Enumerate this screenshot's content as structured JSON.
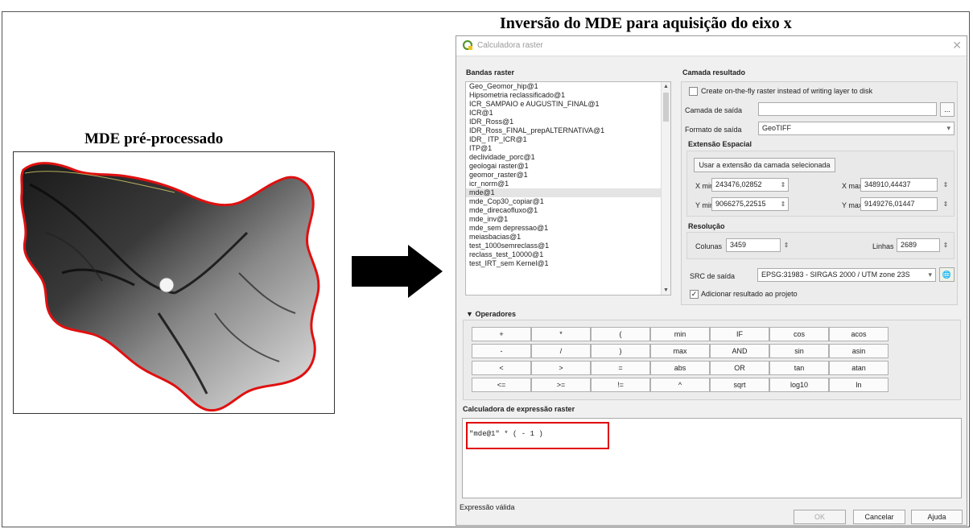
{
  "figure": {
    "left_title": "MDE pré-processado",
    "right_title": "Inversão do MDE para aquisição do eixo x"
  },
  "dialog": {
    "title": "Calculadora raster",
    "close_icon": "close-icon",
    "bands": {
      "heading": "Bandas raster",
      "items": [
        "Geo_Geomor_hip@1",
        "Hipsometria reclassificado@1",
        "ICR_SAMPAIO e AUGUSTIN_FINAL@1",
        "ICR@1",
        "IDR_Ross@1",
        "IDR_Ross_FINAL_prepALTERNATIVA@1",
        "IDR_ ITP_ICR@1",
        "ITP@1",
        "declividade_porc@1",
        "geologai raster@1",
        "geomor_raster@1",
        "icr_norm@1",
        "mde@1",
        "mde_Cop30_copiar@1",
        "mde_direcaofluxo@1",
        "mde_inv@1",
        "mde_sem depressao@1",
        "meiasbacias@1",
        "test_1000semreclass@1",
        "reclass_test_10000@1",
        "test_IRT_sem Kernel@1"
      ],
      "selected_index": 12
    },
    "result": {
      "heading": "Camada resultado",
      "onthefly_label": "Create on-the-fly raster instead of writing layer to disk",
      "output_layer_label": "Camada de saída",
      "output_layer_value": "",
      "browse_label": "...",
      "format_label": "Formato de saída",
      "format_value": "GeoTIFF",
      "extent_heading": "Extensão Espacial",
      "use_extent_button": "Usar a extensão da camada selecionada",
      "xmin_label": "X min",
      "xmin_value": "243476,02852",
      "xmax_label": "X max",
      "xmax_value": "348910,44437",
      "ymin_label": "Y min",
      "ymin_value": "9066275,22515",
      "ymax_label": "Y max",
      "ymax_value": "9149276,01447",
      "resolution_heading": "Resolução",
      "columns_label": "Colunas",
      "columns_value": "3459",
      "rows_label": "Linhas",
      "rows_value": "2689",
      "crs_label": "SRC de saída",
      "crs_value": "EPSG:31983 - SIRGAS 2000 / UTM zone 23S",
      "add_result_label": "Adicionar resultado ao projeto",
      "add_result_checked": true
    },
    "operators": {
      "heading": "Operadores",
      "rows": [
        [
          "+",
          "*",
          "(",
          "min",
          "IF",
          "cos",
          "acos"
        ],
        [
          "-",
          "/",
          ")",
          "max",
          "AND",
          "sin",
          "asin"
        ],
        [
          "<",
          ">",
          "=",
          "abs",
          "OR",
          "tan",
          "atan"
        ],
        [
          "<=",
          ">=",
          "!=",
          "^",
          "sqrt",
          "log10",
          "ln"
        ]
      ]
    },
    "expression": {
      "heading": "Calculadora de expressão raster",
      "text": "\"mde@1\" * ( - 1 )",
      "status": "Expressão válida"
    },
    "footer": {
      "ok": "OK",
      "cancel": "Cancelar",
      "help": "Ajuda"
    }
  },
  "colors": {
    "highlight": "#e00000",
    "qgis_green": "#589632",
    "qgis_yellow": "#f0c419"
  }
}
